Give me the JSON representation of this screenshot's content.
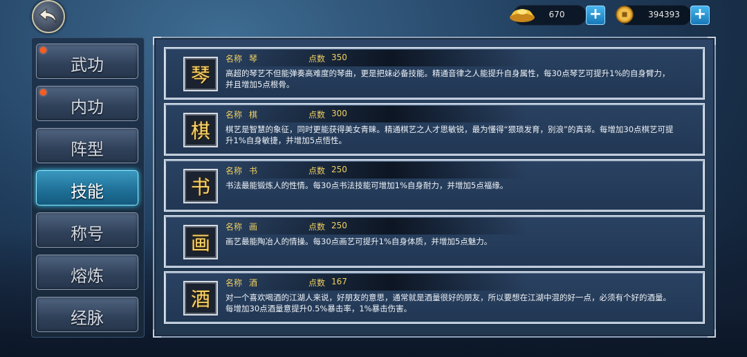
{
  "currencies": [
    {
      "icon": "gold-ingot-icon",
      "value": "670"
    },
    {
      "icon": "coin-icon",
      "value": "394393"
    }
  ],
  "sidebar": {
    "tabs": [
      {
        "label": "武功",
        "has_dot": true,
        "active": false
      },
      {
        "label": "内功",
        "has_dot": true,
        "active": false
      },
      {
        "label": "阵型",
        "has_dot": false,
        "active": false
      },
      {
        "label": "技能",
        "has_dot": false,
        "active": true
      },
      {
        "label": "称号",
        "has_dot": false,
        "active": false
      },
      {
        "label": "熔炼",
        "has_dot": false,
        "active": false
      },
      {
        "label": "经脉",
        "has_dot": false,
        "active": false
      }
    ]
  },
  "labels": {
    "name": "名称",
    "points": "点数"
  },
  "skills": [
    {
      "icon_char": "琴",
      "name": "琴",
      "points": "350",
      "desc": "高超的琴艺不但能弹奏高难度的琴曲，更是把妹必备技能。精通音律之人能提升自身属性，每30点琴艺可提升1%的自身臂力，并且增加5点根骨。"
    },
    {
      "icon_char": "棋",
      "name": "棋",
      "points": "300",
      "desc": "棋艺是智慧的象征，同时更能获得美女青睐。精通棋艺之人才思敏锐，最为懂得“猥琐发育，别浪”的真谛。每增加30点棋艺可提升1%自身敏捷，并增加5点悟性。"
    },
    {
      "icon_char": "书",
      "name": "书",
      "points": "250",
      "desc": "书法最能锻炼人的性情。每30点书法技能可增加1%自身耐力，并增加5点福缘。"
    },
    {
      "icon_char": "画",
      "name": "画",
      "points": "250",
      "desc": "画艺最能陶冶人的情操。每30点画艺可提升1%自身体质，并增加5点魅力。"
    },
    {
      "icon_char": "酒",
      "name": "酒",
      "points": "167",
      "desc": "对一个喜欢喝酒的江湖人来说，好朋友的意思，通常就是酒量很好的朋友，所以要想在江湖中混的好一点，必须有个好的酒量。每增加30点酒量意提升0.5%暴击率，1%暴击伤害。"
    }
  ],
  "colors": {
    "accent": "#f0d060",
    "active_tab": "#3fd6ff",
    "dot": "#ff5a1e"
  }
}
